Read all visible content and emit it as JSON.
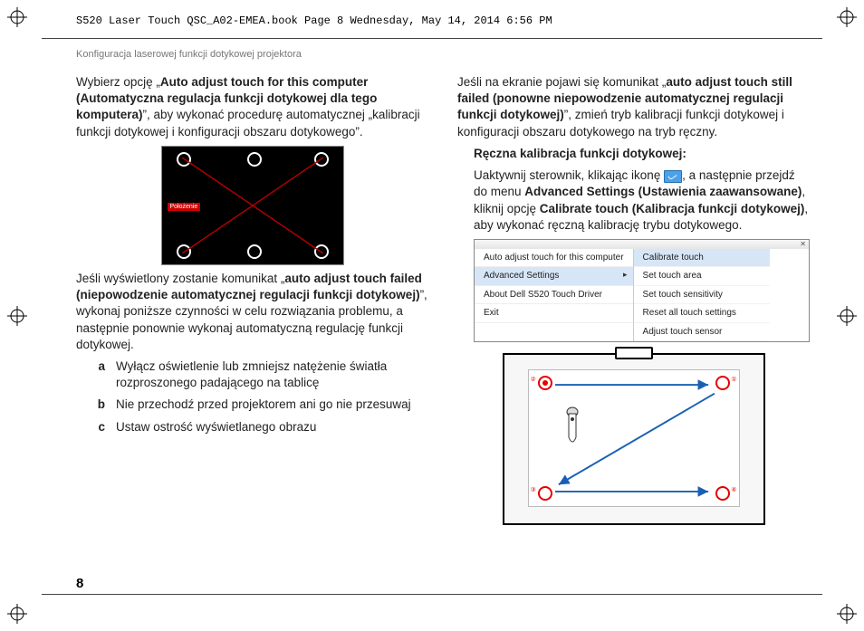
{
  "meta": {
    "print_header": "S520 Laser Touch QSC_A02-EMEA.book  Page 8  Wednesday, May 14, 2014  6:56 PM",
    "section": "Konfiguracja laserowej funkcji dotykowej projektora",
    "page_number": "8"
  },
  "left": {
    "p1_a": "Wybierz opcję „",
    "p1_b": "Auto adjust touch for this computer (Automatyczna regulacja funkcji dotykowej dla tego komputera)",
    "p1_c": "”, aby wykonać procedurę automatycznej „kalibracji funkcji dotykowej i konfiguracji obszaru dotykowego”.",
    "cal_label": "Położenie",
    "p2_a": "Jeśli wyświetlony zostanie komunikat „",
    "p2_b": "auto adjust touch failed (niepowodzenie automatycznej regulacji funkcji dotykowej)",
    "p2_c": "”, wykonaj poniższe czynności w celu rozwiązania problemu, a następnie ponownie wykonaj automatyczną regulację funkcji dotykowej.",
    "a_marker": "a",
    "a_text": "Wyłącz oświetlenie lub zmniejsz natężenie światła rozproszonego padającego na tablicę",
    "b_marker": "b",
    "b_text": "Nie przechodź przed projektorem ani go nie przesuwaj",
    "c_marker": "c",
    "c_text": "Ustaw ostrość wyświetlanego obrazu"
  },
  "right": {
    "p1_a": "Jeśli na ekranie pojawi się komunikat „",
    "p1_b": "auto adjust touch still failed (ponowne niepowodzenie automatycznej regulacji funkcji dotykowej)",
    "p1_c": "”, zmień tryb kalibracji funkcji dotykowej i konfiguracji obszaru dotykowego na tryb ręczny.",
    "h2": "Ręczna kalibracja funkcji dotykowej:",
    "p2_a": "Uaktywnij sterownik, klikając ikonę ",
    "p2_b": ", a następnie przejdź do menu ",
    "p2_c": "Advanced Settings (Ustawienia zaawansowane)",
    "p2_d": ", kliknij opcję ",
    "p2_e": "Calibrate touch (Kalibracja funkcji dotykowej)",
    "p2_f": ", aby wykonać ręczną kalibrację trybu dotykowego.",
    "menu": {
      "left": {
        "auto": "Auto adjust touch for this computer",
        "adv": "Advanced Settings",
        "about": "About Dell S520 Touch Driver",
        "exit": "Exit"
      },
      "right": {
        "cal": "Calibrate touch",
        "area": "Set touch area",
        "sens": "Set touch sensitivity",
        "reset": "Reset all touch settings",
        "adj": "Adjust touch sensor"
      }
    },
    "targets": {
      "n1": "①",
      "n2": "②",
      "n3": "③",
      "n4": "④"
    }
  }
}
